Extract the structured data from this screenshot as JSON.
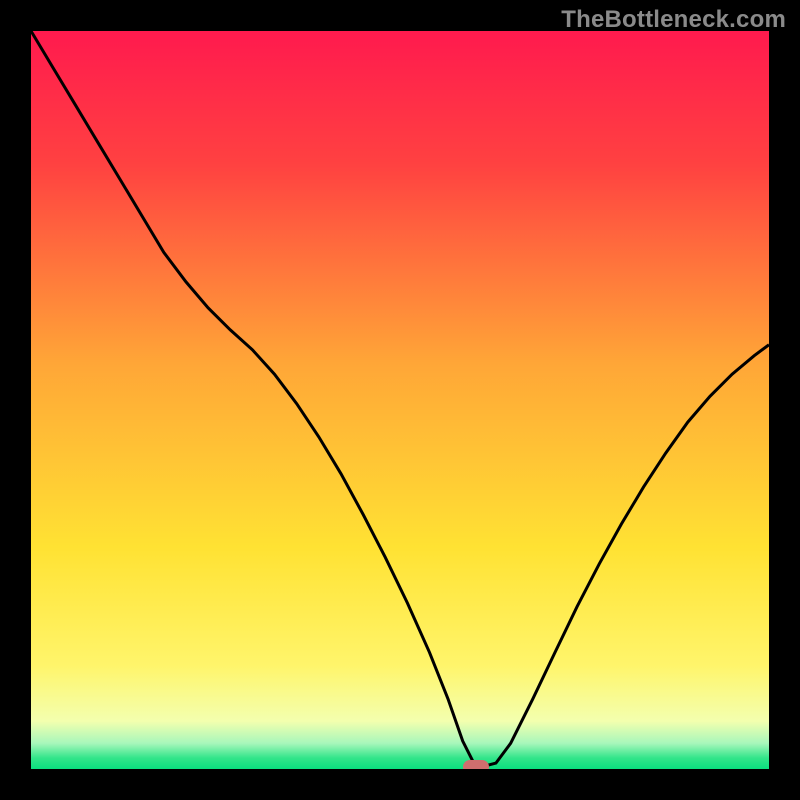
{
  "watermark": "TheBottleneck.com",
  "marker": {
    "color": "#cf6e6e"
  },
  "chart_data": {
    "type": "line",
    "title": "",
    "xlabel": "",
    "ylabel": "",
    "xlim": [
      0,
      100
    ],
    "ylim": [
      0,
      100
    ],
    "grid": false,
    "annotations": [
      "TheBottleneck.com"
    ],
    "background_gradient": [
      {
        "pos": 0.0,
        "color": "#ff1a4e"
      },
      {
        "pos": 0.18,
        "color": "#ff4141"
      },
      {
        "pos": 0.45,
        "color": "#ffa637"
      },
      {
        "pos": 0.7,
        "color": "#ffe233"
      },
      {
        "pos": 0.86,
        "color": "#fff56b"
      },
      {
        "pos": 0.935,
        "color": "#f3ffae"
      },
      {
        "pos": 0.965,
        "color": "#a8f7bb"
      },
      {
        "pos": 0.985,
        "color": "#33e58a"
      },
      {
        "pos": 1.0,
        "color": "#0adf7f"
      }
    ],
    "marker": {
      "x": 60.3,
      "y": 0,
      "color": "#cf6e6e"
    },
    "series": [
      {
        "name": "bottleneck-curve",
        "color": "#000000",
        "width": 3,
        "x": [
          0.0,
          3.0,
          6.0,
          9.0,
          12.0,
          15.0,
          18.0,
          21.0,
          24.0,
          27.0,
          30.0,
          33.0,
          36.0,
          39.0,
          42.0,
          45.0,
          48.0,
          51.0,
          54.0,
          56.5,
          58.5,
          60.0,
          61.5,
          63.0,
          65.0,
          68.0,
          71.0,
          74.0,
          77.0,
          80.0,
          83.0,
          86.0,
          89.0,
          92.0,
          95.0,
          98.0,
          100.0
        ],
        "y": [
          100.0,
          95.0,
          90.0,
          85.0,
          80.0,
          75.0,
          70.0,
          66.0,
          62.5,
          59.5,
          56.8,
          53.5,
          49.5,
          45.0,
          40.0,
          34.5,
          28.7,
          22.5,
          15.8,
          9.5,
          3.8,
          0.8,
          0.4,
          0.8,
          3.5,
          9.5,
          15.8,
          22.0,
          27.8,
          33.2,
          38.2,
          42.8,
          47.0,
          50.5,
          53.5,
          56.0,
          57.5
        ]
      }
    ]
  }
}
